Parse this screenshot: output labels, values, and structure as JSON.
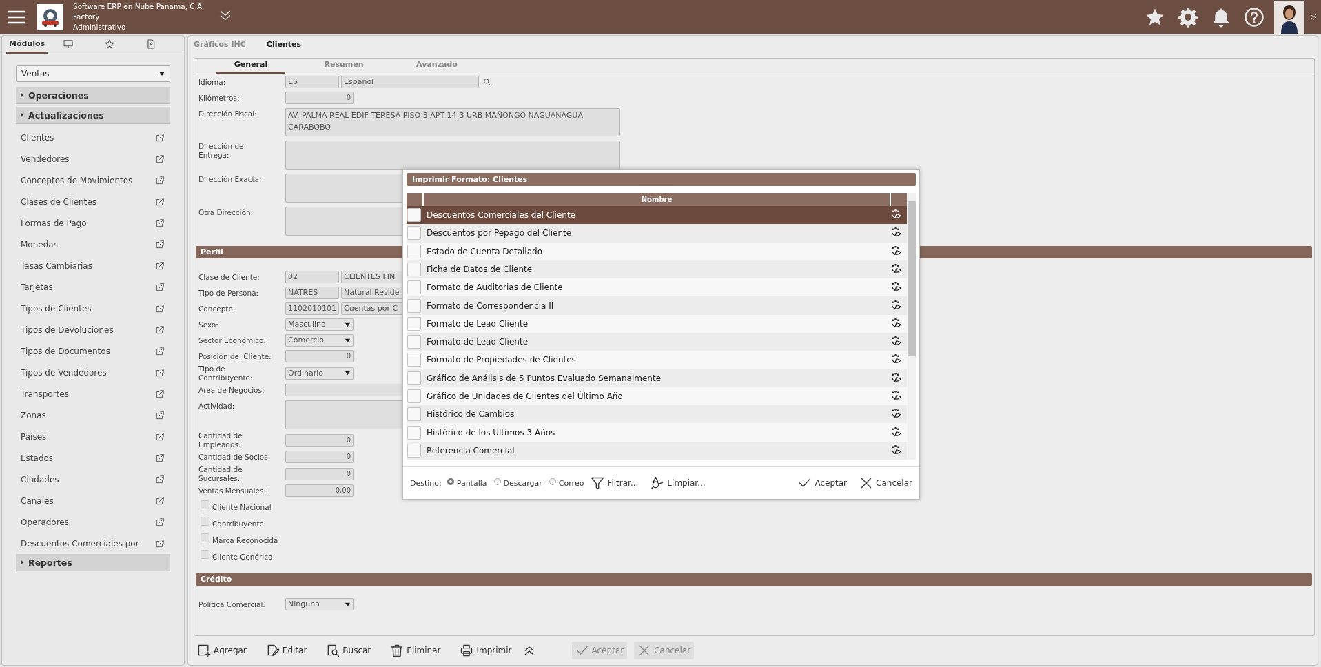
{
  "header": {
    "title_lines": [
      "Software ERP en Nube Panama, C.A.",
      "Factory",
      "Administrativo"
    ]
  },
  "sidebar": {
    "tabs": [
      {
        "kind": "text",
        "label": "Módulos",
        "selected": true
      },
      {
        "kind": "monitor",
        "selected": false
      },
      {
        "kind": "star",
        "selected": false
      },
      {
        "kind": "document",
        "selected": false
      }
    ],
    "module": "Ventas",
    "groups": [
      {
        "label": "Operaciones"
      },
      {
        "label": "Actualizaciones",
        "items": [
          "Clientes",
          "Vendedores",
          "Conceptos de Movimientos",
          "Clases de Clientes",
          "Formas de Pago",
          "Monedas",
          "Tasas Cambiarias",
          "Tarjetas",
          "Tipos de Clientes",
          "Tipos de Devoluciones",
          "Tipos de Documentos",
          "Tipos de Vendedores",
          "Transportes",
          "Zonas",
          "Paises",
          "Estados",
          "Ciudades",
          "Canales",
          "Operadores",
          "Descuentos Comerciales por"
        ]
      },
      {
        "label": "Reportes"
      }
    ]
  },
  "tabs": [
    {
      "label": "Gráficos IHC",
      "selected": false
    },
    {
      "label": "Clientes",
      "selected": true
    }
  ],
  "subtabs": [
    {
      "label": "General",
      "selected": true
    },
    {
      "label": "Resumen",
      "selected": false
    },
    {
      "label": "Avanzado",
      "selected": false
    }
  ],
  "form": [
    {
      "kind": "lookup",
      "label": "Idioma:",
      "code": "ES",
      "value": "Español"
    },
    {
      "kind": "number",
      "label": "Kilómetros:",
      "value": "0"
    },
    {
      "kind": "address",
      "label": "Dirección Fiscal:",
      "lines": [
        "AV. PALMA REAL EDIF TERESA PISO 3 APT 14-3 URB MAÑONGO NAGUANAGUA",
        "CARABOBO"
      ]
    },
    {
      "kind": "textarea",
      "label": "Dirección de\nEntrega:"
    },
    {
      "kind": "textarea",
      "label": "Dirección Exacta:"
    },
    {
      "kind": "textarea",
      "label": "Otra Dirección:"
    },
    {
      "kind": "section",
      "label": "Perfil"
    },
    {
      "kind": "pair",
      "label": "Clase de Cliente:",
      "code": "02",
      "value": "CLIENTES FIN"
    },
    {
      "kind": "pair",
      "label": "Tipo de Persona:",
      "code": "NATRES",
      "value": "Natural Reside"
    },
    {
      "kind": "pair",
      "label": "Concepto:",
      "code": "1102010101",
      "value": "Cuentas por C"
    },
    {
      "kind": "select",
      "label": "Sexo:",
      "value": "Masculino"
    },
    {
      "kind": "select",
      "label": "Sector Económico:",
      "value": "Comercio"
    },
    {
      "kind": "number",
      "label": "Posición del Cliente:",
      "value": "0"
    },
    {
      "kind": "select",
      "label": "Tipo de\nContribuyente:",
      "value": "Ordinario"
    },
    {
      "kind": "text",
      "label": "Area de Negocios:"
    },
    {
      "kind": "textarea",
      "label": "Actividad:"
    },
    {
      "kind": "number",
      "label": "Cantidad de\nEmpleados:",
      "value": "0"
    },
    {
      "kind": "number",
      "label": "Cantidad de Socios:",
      "value": "0"
    },
    {
      "kind": "number",
      "label": "Cantidad de\nSucursales:",
      "value": "0"
    },
    {
      "kind": "number",
      "label": "Ventas Mensuales:",
      "value": "0,00"
    },
    {
      "kind": "checkbox",
      "label": "Cliente Nacional",
      "checked": false
    },
    {
      "kind": "checkbox",
      "label": "Contribuyente",
      "checked": false
    },
    {
      "kind": "checkbox",
      "label": "Marca Reconocida",
      "checked": false
    },
    {
      "kind": "checkbox",
      "label": "Cliente Genérico",
      "checked": false
    },
    {
      "kind": "section",
      "label": "Crédito"
    },
    {
      "kind": "select",
      "label": "Politica Comercial:",
      "value": "Ninguna"
    }
  ],
  "toolbar": [
    {
      "kind": "add",
      "label": "Agregar",
      "disabled": false
    },
    {
      "kind": "edit",
      "label": "Editar",
      "disabled": false
    },
    {
      "kind": "search",
      "label": "Buscar",
      "disabled": false
    },
    {
      "kind": "delete",
      "label": "Eliminar",
      "disabled": false
    },
    {
      "kind": "print",
      "label": "Imprimir",
      "disabled": false
    },
    {
      "kind": "expand"
    },
    {
      "kind": "accept",
      "label": "Aceptar",
      "disabled": true
    },
    {
      "kind": "cancel",
      "label": "Cancelar",
      "disabled": true
    }
  ],
  "dialog": {
    "title": "Imprimir Formato: Clientes",
    "column": "Nombre",
    "rows": [
      {
        "name": "Descuentos Comerciales del Cliente",
        "selected": true,
        "checked": false
      },
      {
        "name": "Descuentos por Pepago del Cliente",
        "selected": false,
        "checked": false
      },
      {
        "name": "Estado de Cuenta Detallado",
        "selected": false,
        "checked": false
      },
      {
        "name": "Ficha de Datos de Cliente",
        "selected": false,
        "checked": false
      },
      {
        "name": "Formato de Auditorias de Cliente",
        "selected": false,
        "checked": false
      },
      {
        "name": "Formato de Correspondencia II",
        "selected": false,
        "checked": false
      },
      {
        "name": "Formato de Lead Cliente",
        "selected": false,
        "checked": false
      },
      {
        "name": "Formato de Lead Cliente",
        "selected": false,
        "checked": false
      },
      {
        "name": "Formato de Propiedades de Clientes",
        "selected": false,
        "checked": false
      },
      {
        "name": "Gráfico de Análisis de 5 Puntos Evaluado Semanalmente",
        "selected": false,
        "checked": false
      },
      {
        "name": "Gráfico de Unidades de Clientes del Último Año",
        "selected": false,
        "checked": false
      },
      {
        "name": "Histórico de Cambios",
        "selected": false,
        "checked": false
      },
      {
        "name": "Histórico de los Ultimos 3 Años",
        "selected": false,
        "checked": false
      },
      {
        "name": "Referencia Comercial",
        "selected": false,
        "checked": false
      }
    ],
    "destination_label": "Destino:",
    "destinations": [
      {
        "label": "Pantalla",
        "selected": true
      },
      {
        "label": "Descargar",
        "selected": false
      },
      {
        "label": "Correo",
        "selected": false
      }
    ],
    "actions": [
      {
        "kind": "filter",
        "label": "Filtrar..."
      },
      {
        "kind": "clear",
        "label": "Limpiar..."
      },
      {
        "kind": "accept",
        "label": "Aceptar"
      },
      {
        "kind": "cancel",
        "label": "Cancelar"
      }
    ]
  }
}
